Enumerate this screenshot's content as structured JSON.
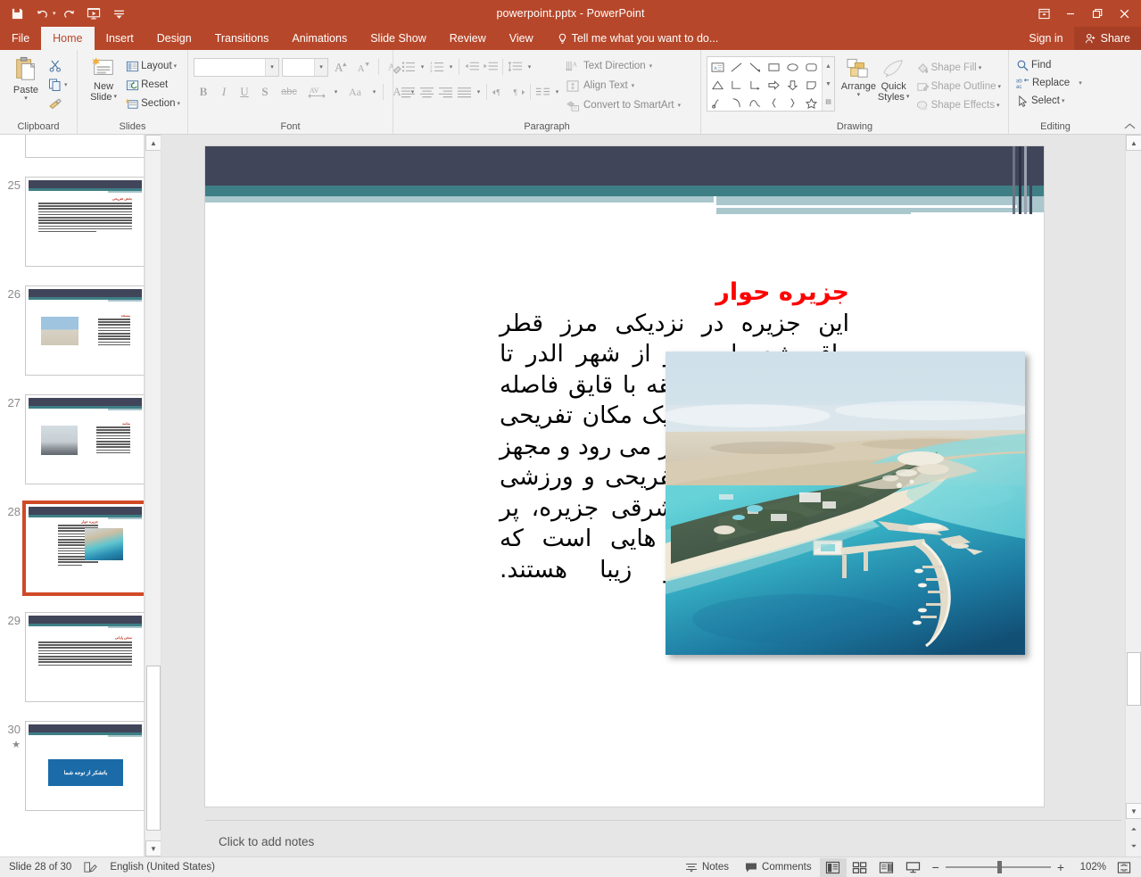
{
  "titlebar": {
    "document_title": "powerpoint.pptx - PowerPoint",
    "qat": [
      {
        "name": "save-icon",
        "label": "Save"
      },
      {
        "name": "undo-icon",
        "label": "Undo"
      },
      {
        "name": "redo-icon",
        "label": "Redo"
      },
      {
        "name": "start-presentation-icon",
        "label": "Start From Beginning"
      },
      {
        "name": "customize-qat-icon",
        "label": "Customize Quick Access Toolbar"
      }
    ],
    "window_controls": [
      {
        "name": "ribbon-display-options-icon",
        "label": "Ribbon Display Options"
      },
      {
        "name": "minimize-icon",
        "label": "Minimize"
      },
      {
        "name": "restore-icon",
        "label": "Restore Down"
      },
      {
        "name": "close-icon",
        "label": "Close"
      }
    ]
  },
  "tabs": [
    {
      "label": "File",
      "active": false
    },
    {
      "label": "Home",
      "active": true
    },
    {
      "label": "Insert",
      "active": false
    },
    {
      "label": "Design",
      "active": false
    },
    {
      "label": "Transitions",
      "active": false
    },
    {
      "label": "Animations",
      "active": false
    },
    {
      "label": "Slide Show",
      "active": false
    },
    {
      "label": "Review",
      "active": false
    },
    {
      "label": "View",
      "active": false
    }
  ],
  "tellme": {
    "placeholder": "Tell me what you want to do..."
  },
  "account": {
    "signin_label": "Sign in",
    "share_label": "Share"
  },
  "ribbon": {
    "clipboard": {
      "label": "Clipboard",
      "paste_label": "Paste",
      "cut_label": "Cut",
      "copy_label": "Copy",
      "format_painter_label": "Format Painter"
    },
    "slides": {
      "label": "Slides",
      "new_slide_label": "New\nSlide",
      "new_slide_line1": "New",
      "new_slide_line2": "Slide",
      "layout_label": "Layout",
      "reset_label": "Reset",
      "section_label": "Section"
    },
    "font": {
      "label": "Font",
      "font_name_value": "",
      "font_name_placeholder": "",
      "font_size_value": "",
      "grow_font_label": "A",
      "shrink_font_label": "A",
      "clear_formatting_label": "Clear All Formatting",
      "bold_label": "B",
      "italic_label": "I",
      "underline_label": "U",
      "shadow_label": "S",
      "strikethrough_label": "abc",
      "char_spacing_label": "AV",
      "change_case_label": "Aa",
      "font_color_label": "A"
    },
    "paragraph": {
      "label": "Paragraph",
      "text_direction_label": "Text Direction",
      "align_text_label": "Align Text",
      "convert_smartart_label": "Convert to SmartArt"
    },
    "drawing": {
      "label": "Drawing",
      "arrange_label": "Arrange",
      "quick_styles_line1": "Quick",
      "quick_styles_line2": "Styles",
      "shape_fill_label": "Shape Fill",
      "shape_outline_label": "Shape Outline",
      "shape_effects_label": "Shape Effects"
    },
    "editing": {
      "label": "Editing",
      "find_label": "Find",
      "replace_label": "Replace",
      "select_label": "Select"
    }
  },
  "thumbnails": [
    {
      "number": "",
      "type": "text-only-partial",
      "selected": false,
      "starred": false
    },
    {
      "number": "25",
      "type": "text-only",
      "selected": false,
      "starred": false
    },
    {
      "number": "26",
      "type": "photo-left-text-right",
      "selected": false,
      "starred": false
    },
    {
      "number": "27",
      "type": "photo-left-text-right",
      "selected": false,
      "starred": false
    },
    {
      "number": "28",
      "type": "text-left-photo-right",
      "selected": true,
      "starred": false
    },
    {
      "number": "29",
      "type": "text-only",
      "selected": false,
      "starred": false
    },
    {
      "number": "30",
      "type": "closing",
      "selected": false,
      "starred": true,
      "closing_text": "باتشکر از توجه شما"
    }
  ],
  "slide": {
    "title": "جزیره حوار",
    "body": "این جزیره در نزدیکی مرز قطر واقع شده است و از شهر الدر تا این جزیره 45 دقیقه با قایق فاصله دارد. جزیره حوار یک مکان تفریحی و توریستی به شمار می رود و مجهز به انواع امکانات تفریحی و ورزشی می باشد. بخش شرقی جزیره، پر از صخره پرتگاه هایی است که بسیار دیدنی و زیبا هستند.",
    "photo_alt": "aerial-view-of-hawar-island-resort",
    "colors": {
      "title_red": "#ff0000",
      "header_dark": "#41455a",
      "header_teal": "#3d7f85",
      "header_light": "#a9c7cd"
    }
  },
  "notes": {
    "placeholder": "Click to add notes"
  },
  "statusbar": {
    "slide_indicator": "Slide 28 of 30",
    "language": "English (United States)",
    "notes_label": "Notes",
    "comments_label": "Comments",
    "views": [
      {
        "name": "normal-view-icon",
        "label": "Normal",
        "active": true
      },
      {
        "name": "slide-sorter-view-icon",
        "label": "Slide Sorter",
        "active": false
      },
      {
        "name": "reading-view-icon",
        "label": "Reading View",
        "active": false
      },
      {
        "name": "slide-show-icon",
        "label": "Slide Show",
        "active": false
      }
    ],
    "zoom_out_label": "−",
    "zoom_in_label": "+",
    "zoom_level": "102%",
    "fit_label": "Fit slide to current window"
  }
}
